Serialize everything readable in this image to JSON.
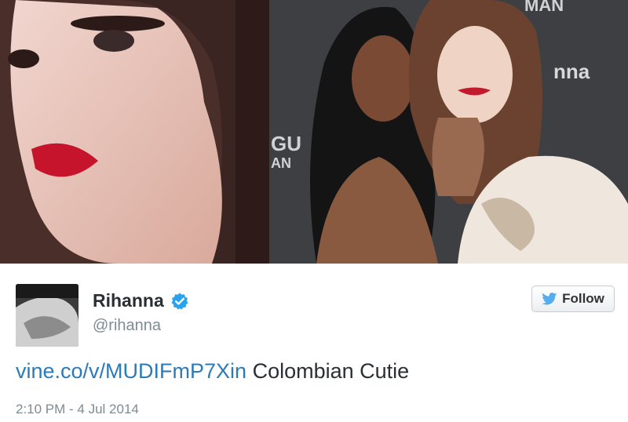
{
  "photos": {
    "left": {
      "alt_icon": "portrait-photo"
    },
    "right": {
      "alt_icon": "event-photo",
      "backdrop_text_1": "MAN",
      "backdrop_text_2": "nna",
      "backdrop_text_3": "GU",
      "backdrop_text_4": "AN"
    }
  },
  "tweet": {
    "display_name": "Rihanna",
    "handle": "@rihanna",
    "follow_label": "Follow",
    "link_text": "vine.co/v/MUDIFmP7Xin",
    "body_text": "Colombian Cutie",
    "timestamp": "2:10 PM - 4 Jul 2014"
  },
  "colors": {
    "link": "#2b7bb9",
    "verified": "#2aa3ef",
    "twitter_bird": "#55acee"
  }
}
